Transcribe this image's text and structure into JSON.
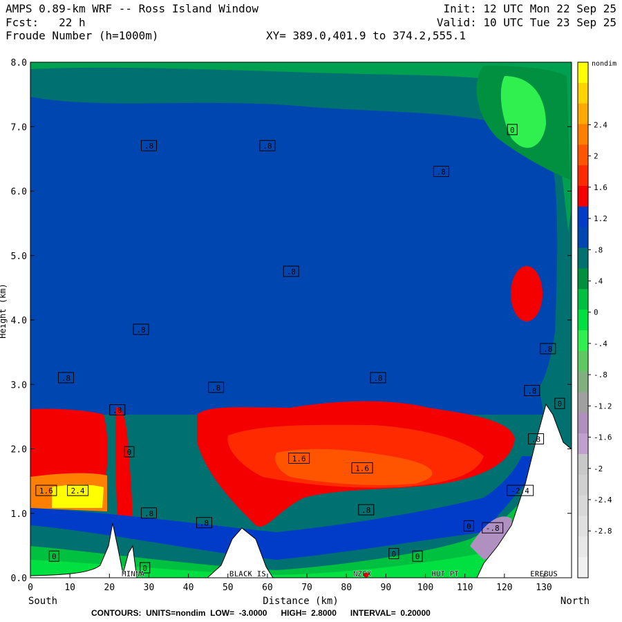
{
  "header": {
    "line1_left": "AMPS 0.89-km WRF -- Ross Island Window",
    "line2_left": "Fcst:   22 h",
    "line3_left": "Froude Number (h=1000m)",
    "line1_right": "Init: 12 UTC Mon 22 Sep 25",
    "line2_right": "Valid: 10 UTC Tue 23 Sep 25",
    "xy_text": "XY= 389.0,401.9 to 374.2,555.1"
  },
  "footer": {
    "contours": "CONTOURS:  UNITS=nondim  LOW=  -3.0000      HIGH=  2.8000      INTERVAL=  0.20000"
  },
  "chart_data": {
    "type": "heatmap",
    "title": "Froude Number (h=1000m)",
    "xlabel": "Distance (km)",
    "ylabel": "Height (km)",
    "xlim": [
      0,
      137
    ],
    "ylim": [
      0,
      8
    ],
    "x_ticks": [
      0,
      10,
      20,
      30,
      40,
      50,
      60,
      70,
      80,
      90,
      100,
      110,
      120,
      130
    ],
    "y_ticks": [
      "0.0",
      "1.0",
      "2.0",
      "3.0",
      "4.0",
      "5.0",
      "6.0",
      "7.0",
      "8.0"
    ],
    "x_end_labels": {
      "left": "South",
      "right": "North"
    },
    "terrain_labels": [
      {
        "text": "MINNA",
        "x": 26
      },
      {
        "text": "BLACK IS",
        "x": 55
      },
      {
        "text": "NZFX",
        "x": 84
      },
      {
        "text": "HUT PT",
        "x": 105
      },
      {
        "text": "EREBUS",
        "x": 130
      }
    ],
    "contour_labels": [
      {
        "text": ".8",
        "x": 30,
        "y": 6.7
      },
      {
        "text": ".8",
        "x": 60,
        "y": 6.7
      },
      {
        "text": ".8",
        "x": 104,
        "y": 6.3
      },
      {
        "text": "0",
        "x": 122,
        "y": 6.95
      },
      {
        "text": ".8",
        "x": 66,
        "y": 4.75
      },
      {
        "text": ".8",
        "x": 28,
        "y": 3.85
      },
      {
        "text": ".8",
        "x": 9,
        "y": 3.1
      },
      {
        "text": ".8",
        "x": 47,
        "y": 2.95
      },
      {
        "text": ".8",
        "x": 88,
        "y": 3.1
      },
      {
        "text": ".8",
        "x": 131,
        "y": 3.55
      },
      {
        "text": ".8",
        "x": 127,
        "y": 2.9
      },
      {
        "text": "0",
        "x": 134,
        "y": 2.7
      },
      {
        "text": ".8",
        "x": 22,
        "y": 2.6
      },
      {
        "text": "0",
        "x": 25,
        "y": 1.95
      },
      {
        "text": "1.6",
        "x": 68,
        "y": 1.85
      },
      {
        "text": "1.6",
        "x": 84,
        "y": 1.7
      },
      {
        "text": "1.6",
        "x": 4,
        "y": 1.35
      },
      {
        "text": "2.4",
        "x": 12,
        "y": 1.35
      },
      {
        "text": ".8",
        "x": 128,
        "y": 2.15
      },
      {
        "text": "-2.4",
        "x": 124,
        "y": 1.35
      },
      {
        "text": ".8",
        "x": 30,
        "y": 1.0
      },
      {
        "text": ".8",
        "x": 44,
        "y": 0.85
      },
      {
        "text": ".8",
        "x": 85,
        "y": 1.05
      },
      {
        "text": "0",
        "x": 111,
        "y": 0.8
      },
      {
        "text": "-.8",
        "x": 117,
        "y": 0.77
      },
      {
        "text": "0",
        "x": 6,
        "y": 0.33
      },
      {
        "text": "0",
        "x": 92,
        "y": 0.37
      },
      {
        "text": "0",
        "x": 98,
        "y": 0.33
      },
      {
        "text": "0",
        "x": 29,
        "y": 0.15
      }
    ],
    "colorbar": {
      "unit_label": "nondim",
      "tick_labels": [
        "2.4",
        "2",
        "1.6",
        "1.2",
        ".8",
        ".4",
        "0",
        "-.4",
        "-.8",
        "-1.2",
        "-1.6",
        "-2",
        "-2.4",
        "-2.8"
      ],
      "colors": [
        "#ffff00",
        "#ffd400",
        "#ffaa00",
        "#ff8000",
        "#ff5500",
        "#ff2a00",
        "#f50000",
        "#003cc8",
        "#0046b0",
        "#007070",
        "#009040",
        "#00c040",
        "#00e040",
        "#30f050",
        "#60c860",
        "#80b080",
        "#a0a0a0",
        "#b090c0",
        "#c0a0d0",
        "#c8c8c8",
        "#d0d0d0",
        "#d8d8d8",
        "#e0e0e0",
        "#e8e8e8",
        "#f0f0f0"
      ]
    },
    "contour_low": -3.0,
    "contour_high": 2.8,
    "contour_interval": 0.2
  }
}
